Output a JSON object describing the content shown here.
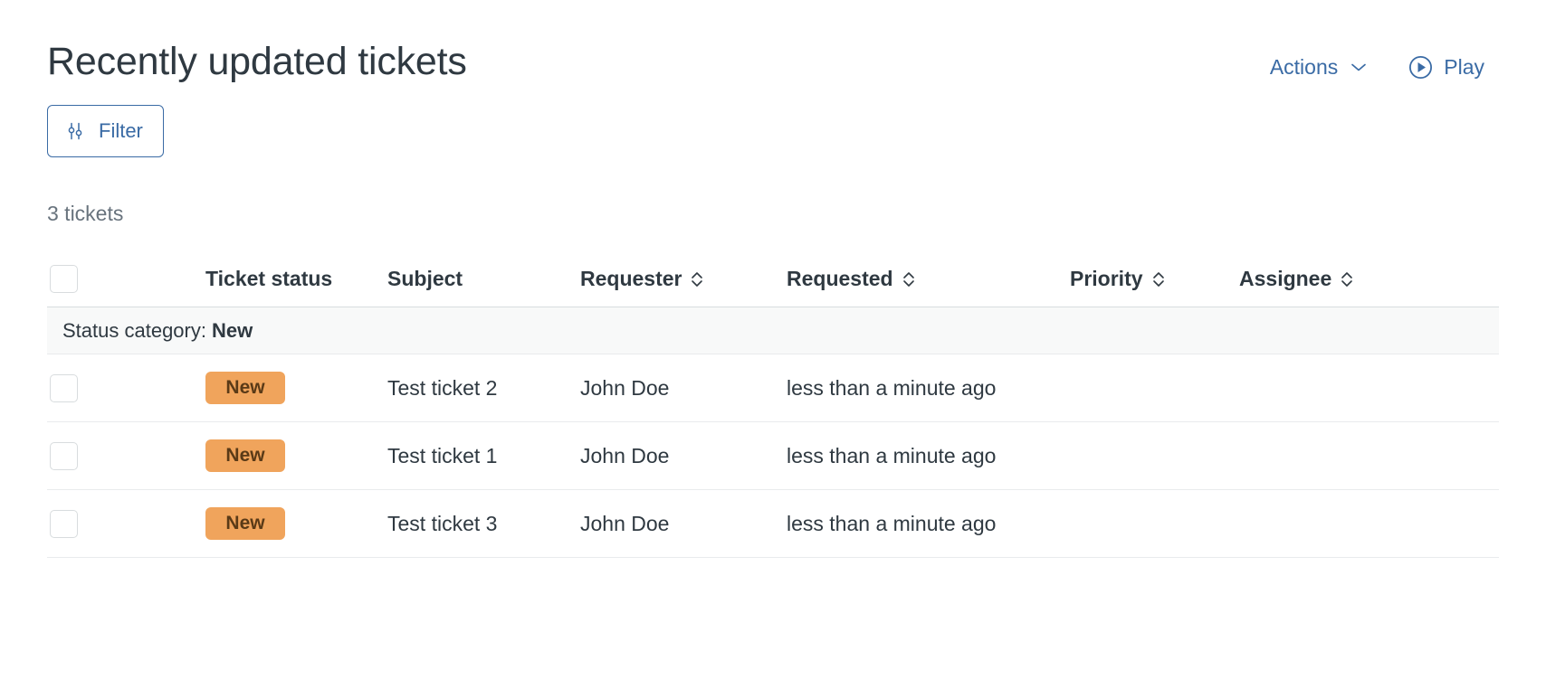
{
  "header": {
    "title": "Recently updated tickets",
    "actions_label": "Actions",
    "actions_icon": "chevron-down-icon",
    "play_label": "Play",
    "play_icon": "play-circle-icon"
  },
  "toolbar": {
    "filter_label": "Filter",
    "filter_icon": "sliders-icon"
  },
  "summary": {
    "count_label": "3 tickets"
  },
  "table": {
    "select_all_icon": "checkbox-unchecked-icon",
    "columns": [
      {
        "label": "Ticket status",
        "sortable": false
      },
      {
        "label": "Subject",
        "sortable": false
      },
      {
        "label": "Requester",
        "sortable": true
      },
      {
        "label": "Requested",
        "sortable": true
      },
      {
        "label": "Priority",
        "sortable": true
      },
      {
        "label": "Assignee",
        "sortable": true
      }
    ],
    "group": {
      "prefix": "Status category:",
      "value": "New"
    },
    "rows": [
      {
        "status": "New",
        "subject": "Test ticket 2",
        "requester": "John Doe",
        "requested": "less than a minute ago",
        "priority": "",
        "assignee": ""
      },
      {
        "status": "New",
        "subject": "Test ticket 1",
        "requester": "John Doe",
        "requested": "less than a minute ago",
        "priority": "",
        "assignee": ""
      },
      {
        "status": "New",
        "subject": "Test ticket 3",
        "requester": "John Doe",
        "requested": "less than a minute ago",
        "priority": "",
        "assignee": ""
      }
    ]
  },
  "colors": {
    "link": "#3a6ba5",
    "text": "#2f3941",
    "muted": "#68737d",
    "badge_bg": "#f0a45c",
    "badge_text": "#5a3a17",
    "border": "#e9ebed",
    "group_bg": "#f8f9f9"
  }
}
